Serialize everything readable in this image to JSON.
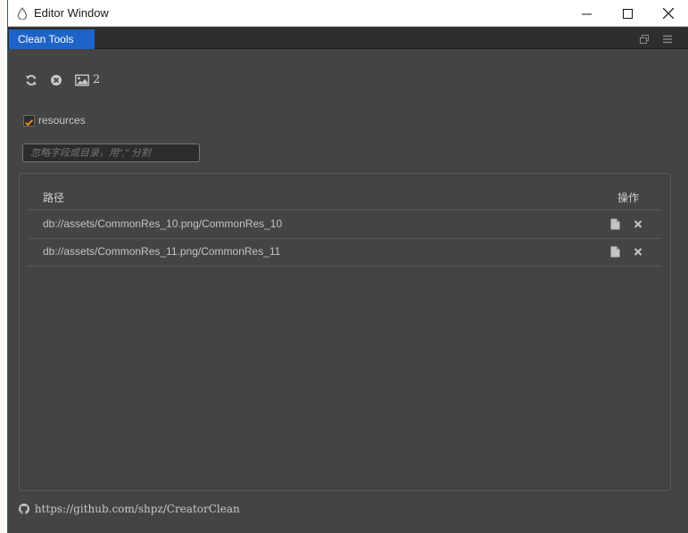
{
  "window": {
    "title": "Editor Window"
  },
  "tab": {
    "label": "Clean Tools"
  },
  "toolbar": {
    "image_count": "2"
  },
  "filter": {
    "checkbox_label": "resources",
    "checked": true
  },
  "ignore_input": {
    "placeholder": "忽略字段或目录，用\",\" 分割",
    "value": ""
  },
  "table": {
    "headers": {
      "path": "路径",
      "action": "操作"
    },
    "rows": [
      {
        "path": "db://assets/CommonRes_10.png/CommonRes_10"
      },
      {
        "path": "db://assets/CommonRes_11.png/CommonRes_11"
      }
    ]
  },
  "footer": {
    "link": "https://github.com/shpz/CreatorClean"
  },
  "colors": {
    "accent": "#1e63c8",
    "checkbox": "#e8891a",
    "panel": "#444444"
  },
  "icons": [
    "app-icon",
    "minimize-icon",
    "maximize-icon",
    "close-icon",
    "popout-icon",
    "menu-icon",
    "refresh-icon",
    "clear-icon",
    "image-icon",
    "file-icon",
    "delete-icon",
    "github-icon"
  ]
}
